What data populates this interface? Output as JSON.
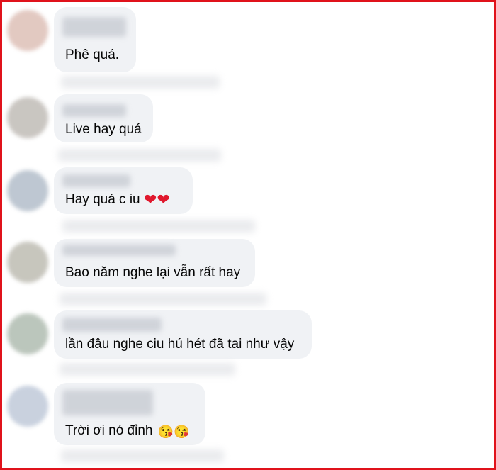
{
  "comments": [
    {
      "text": "Phê quá.",
      "emoji": "",
      "avatar_color": "#d9b7ad"
    },
    {
      "text": "Live hay quá",
      "emoji": "",
      "avatar_color": "#b8b3ad"
    },
    {
      "text": "Hay quá c iu ",
      "emoji": "❤❤",
      "avatar_color": "#a9b5c3"
    },
    {
      "text": "Bao năm nghe lại vẫn rất hay",
      "emoji": "",
      "avatar_color": "#b5b3a8"
    },
    {
      "text": "lần đâu nghe ciu hú hét đã tai như vậy",
      "emoji": "",
      "avatar_color": "#a5b3a6"
    },
    {
      "text": "Trời ơi nó đỉnh ",
      "emoji": "😘😘",
      "avatar_color": "#b7c2d4"
    }
  ],
  "colors": {
    "frame": "#e0121b",
    "bubble": "#f0f2f5",
    "text": "#050505"
  }
}
